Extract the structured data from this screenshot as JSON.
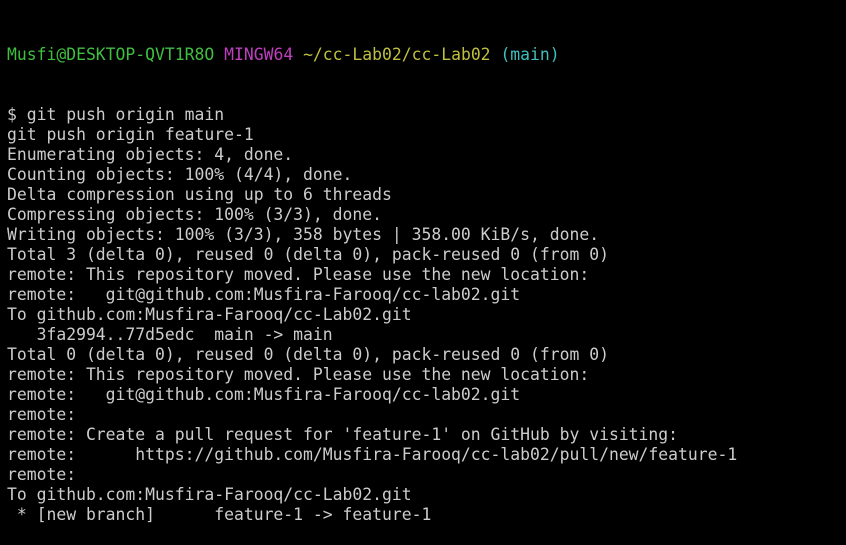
{
  "prompt": {
    "user_host": "Musfi@DESKTOP-QVT1R8O",
    "env": "MINGW64",
    "path": "~/cc-Lab02/cc-Lab02",
    "branch": "(main)"
  },
  "output_lines": [
    "$ git push origin main",
    "git push origin feature-1",
    "Enumerating objects: 4, done.",
    "Counting objects: 100% (4/4), done.",
    "Delta compression using up to 6 threads",
    "Compressing objects: 100% (3/3), done.",
    "Writing objects: 100% (3/3), 358 bytes | 358.00 KiB/s, done.",
    "Total 3 (delta 0), reused 0 (delta 0), pack-reused 0 (from 0)",
    "remote: This repository moved. Please use the new location:",
    "remote:   git@github.com:Musfira-Farooq/cc-lab02.git",
    "To github.com:Musfira-Farooq/cc-Lab02.git",
    "   3fa2994..77d5edc  main -> main",
    "Total 0 (delta 0), reused 0 (delta 0), pack-reused 0 (from 0)",
    "remote: This repository moved. Please use the new location:",
    "remote:   git@github.com:Musfira-Farooq/cc-lab02.git",
    "remote:",
    "remote: Create a pull request for 'feature-1' on GitHub by visiting:",
    "remote:      https://github.com/Musfira-Farooq/cc-lab02/pull/new/feature-1",
    "remote:",
    "To github.com:Musfira-Farooq/cc-Lab02.git",
    " * [new branch]      feature-1 -> feature-1"
  ],
  "colors": {
    "background": "#000000",
    "text": "#cccccc",
    "user_host": "#3fbf3f",
    "env": "#bf3fbf",
    "path": "#bfbf3f",
    "branch": "#3fbfbf"
  }
}
